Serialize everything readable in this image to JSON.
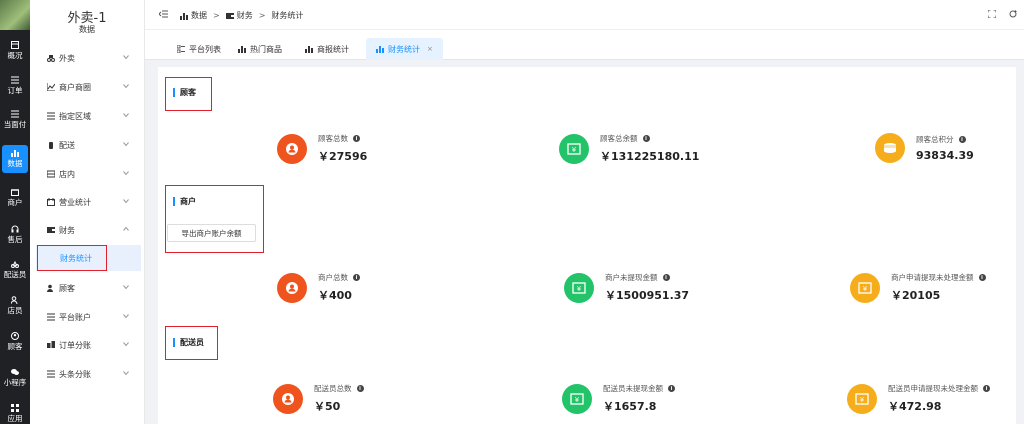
{
  "rail": {
    "items": [
      {
        "label": "概况",
        "icon": "dashboard-icon"
      },
      {
        "label": "订单",
        "icon": "list-icon"
      },
      {
        "label": "当面付",
        "icon": "list-icon"
      },
      {
        "label": "数据",
        "icon": "chart-icon"
      },
      {
        "label": "商户",
        "icon": "store-icon"
      },
      {
        "label": "售后",
        "icon": "headset-icon"
      },
      {
        "label": "配送员",
        "icon": "rider-icon"
      },
      {
        "label": "店员",
        "icon": "people-icon"
      },
      {
        "label": "顾客",
        "icon": "user-circle-icon"
      },
      {
        "label": "小程序",
        "icon": "chat-icon"
      },
      {
        "label": "应用",
        "icon": "apps-icon"
      }
    ]
  },
  "menu": {
    "brand": "外卖-1",
    "subtitle": "数据",
    "items": [
      {
        "label": "外卖"
      },
      {
        "label": "商户商圈"
      },
      {
        "label": "指定区域"
      },
      {
        "label": "配送"
      },
      {
        "label": "店内"
      },
      {
        "label": "营业统计"
      },
      {
        "label": "财务"
      },
      {
        "label": "顾客"
      },
      {
        "label": "平台账户"
      },
      {
        "label": "订单分账"
      },
      {
        "label": "头条分账"
      }
    ],
    "active_sub": "财务统计"
  },
  "breadcrumb": {
    "home": "数据",
    "parent": "财务",
    "current": "财务统计"
  },
  "tabs": [
    {
      "label": "平台列表"
    },
    {
      "label": "热门商品"
    },
    {
      "label": "商报统计"
    },
    {
      "label": "财务统计",
      "close": "×"
    }
  ],
  "sections": {
    "customer": {
      "title": "顾客",
      "stats": [
        {
          "label": "顾客总数",
          "value": "￥27596",
          "color": "#f0541e"
        },
        {
          "label": "顾客总余额",
          "value": "￥131225180.11",
          "color": "#23c36a"
        },
        {
          "label": "顾客总积分",
          "value": "93834.39",
          "color": "#f6ad1c"
        }
      ]
    },
    "merchant": {
      "title": "商户",
      "export_label": "导出商户账户余额",
      "stats": [
        {
          "label": "商户总数",
          "value": "￥400",
          "color": "#f0541e"
        },
        {
          "label": "商户未提现金额",
          "value": "￥1500951.37",
          "color": "#23c36a"
        },
        {
          "label": "商户申请提现未处理金额",
          "value": "￥20105",
          "color": "#f6ad1c"
        }
      ]
    },
    "rider": {
      "title": "配送员",
      "stats": [
        {
          "label": "配送员总数",
          "value": "￥50",
          "color": "#f0541e"
        },
        {
          "label": "配送员未提现金额",
          "value": "￥1657.8",
          "color": "#23c36a"
        },
        {
          "label": "配送员申请提现未处理金额",
          "value": "￥472.98",
          "color": "#f6ad1c"
        }
      ]
    }
  }
}
